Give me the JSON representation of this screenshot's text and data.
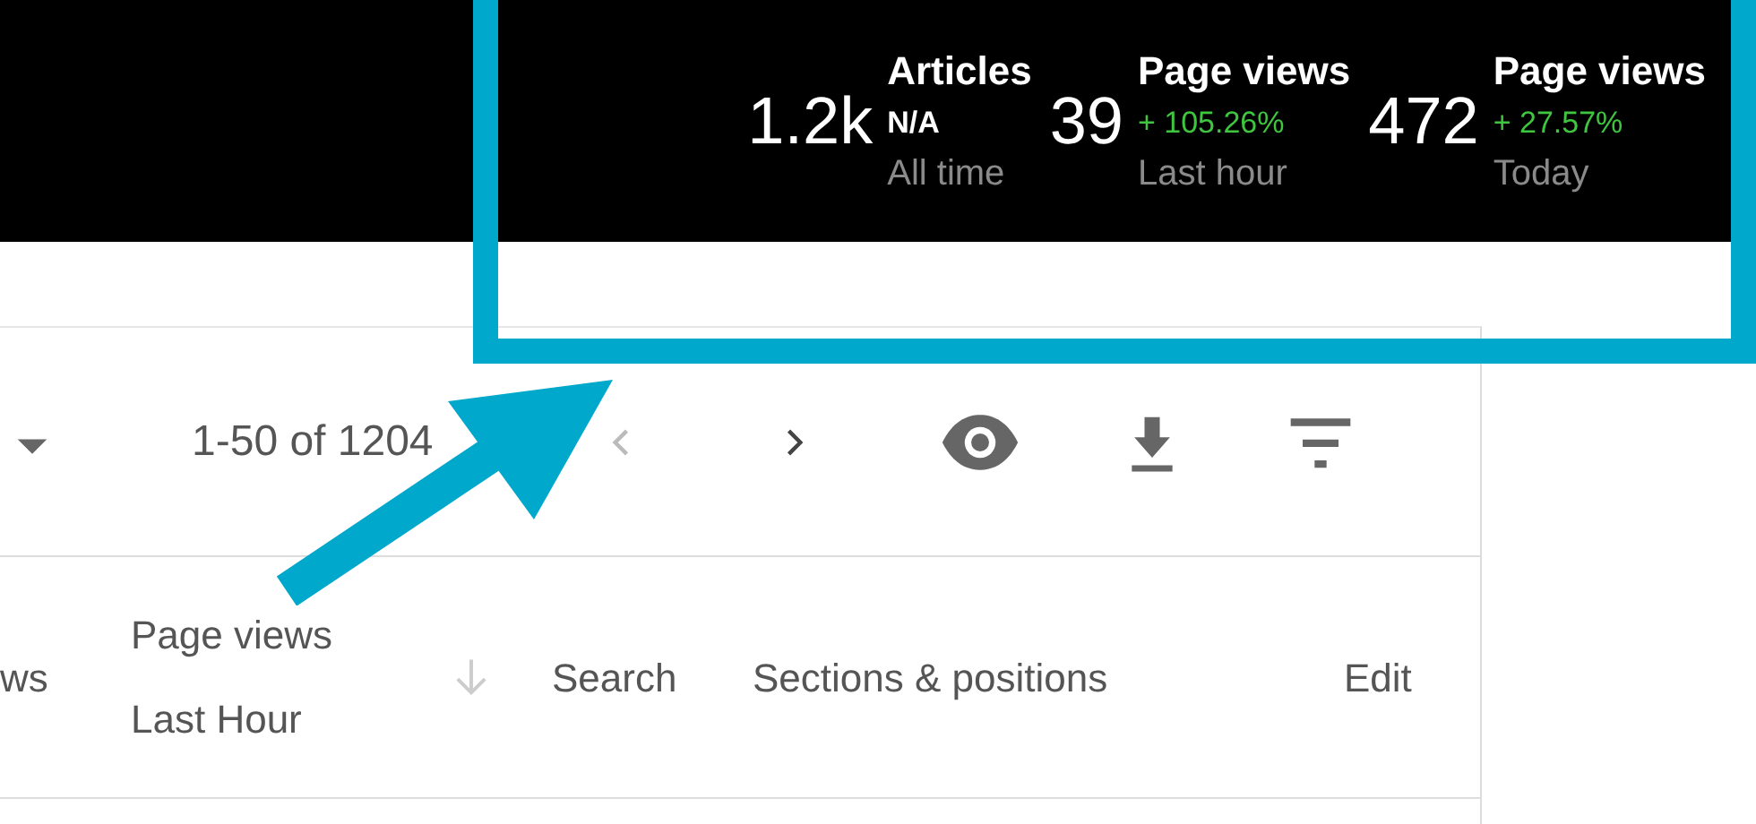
{
  "stats": [
    {
      "value": "1.2k",
      "label": "Articles",
      "change": "N/A",
      "increase": false,
      "period": "All time"
    },
    {
      "value": "39",
      "label": "Page views",
      "change": "+ 105.26%",
      "increase": true,
      "period": "Last hour"
    },
    {
      "value": "472",
      "label": "Page views",
      "change": "+ 27.57%",
      "increase": true,
      "period": "Today"
    }
  ],
  "pager": {
    "range": "1-50 of 1204",
    "prev_disabled": true,
    "next_disabled": false
  },
  "table": {
    "columns": [
      {
        "kind": "text",
        "lines": [
          "ws"
        ]
      },
      {
        "kind": "text",
        "lines": [
          "Page views",
          "Last Hour"
        ]
      },
      {
        "kind": "sort"
      },
      {
        "kind": "text",
        "lines": [
          "Search"
        ]
      },
      {
        "kind": "text",
        "lines": [
          "Sections & positions"
        ]
      },
      {
        "kind": "text",
        "lines": [
          "Edit"
        ]
      }
    ]
  }
}
